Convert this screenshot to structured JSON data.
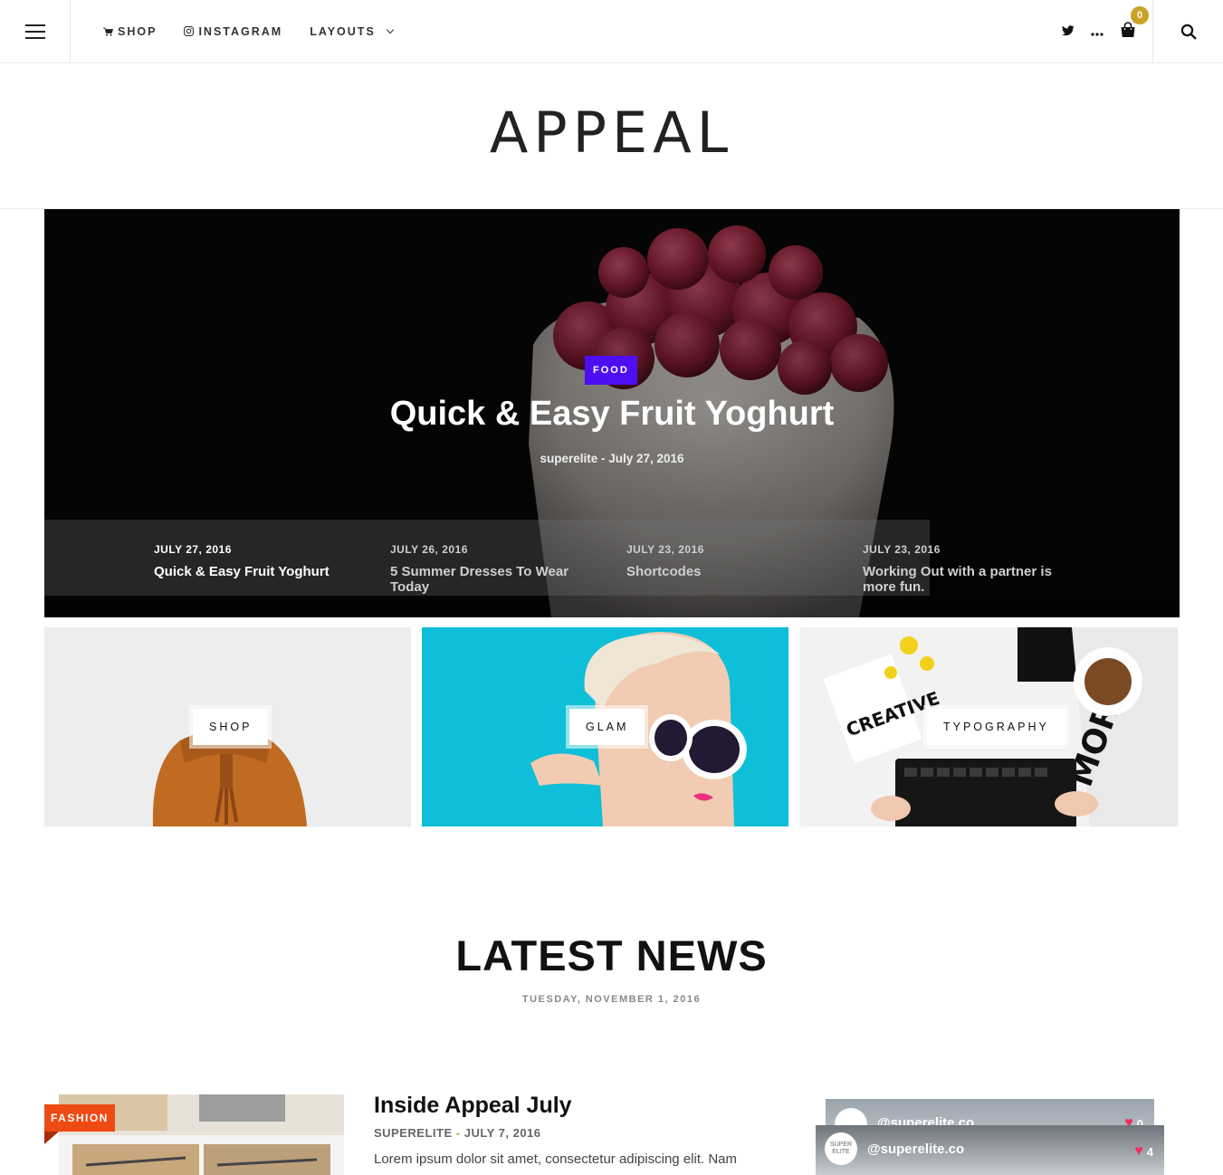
{
  "nav": {
    "shop_label": "SHOP",
    "instagram_label": "INSTAGRAM",
    "layouts_label": "LAYOUTS",
    "cart_count": "0"
  },
  "site": {
    "logo": "APPEAL"
  },
  "hero": {
    "category": "FOOD",
    "title": "Quick & Easy Fruit Yoghurt",
    "meta": "superelite - July 27, 2016",
    "category_color": "#4d0ef2",
    "slides": [
      {
        "date": "JULY 27, 2016",
        "title": "Quick & Easy Fruit Yoghurt"
      },
      {
        "date": "JULY 26, 2016",
        "title": "5 Summer Dresses To Wear Today"
      },
      {
        "date": "JULY 23, 2016",
        "title": "Shortcodes"
      },
      {
        "date": "JULY 23, 2016",
        "title": "Working Out with a partner is more fun."
      }
    ]
  },
  "tiles": [
    {
      "label": "SHOP"
    },
    {
      "label": "GLAM"
    },
    {
      "label": "TYPOGRAPHY"
    }
  ],
  "latest": {
    "title": "LATEST NEWS",
    "date": "TUESDAY, NOVEMBER 1, 2016"
  },
  "post": {
    "category": "FASHION",
    "category_color": "#ee4a13",
    "title": "Inside Appeal July",
    "author": "SUPERELITE",
    "date": "JULY 7, 2016",
    "excerpt": "Lorem ipsum dolor sit amet, consectetur adipiscing elit. Nam"
  },
  "instagram": {
    "back": {
      "handle": "@superelite.co",
      "likes": "0"
    },
    "front": {
      "handle": "@superelite.co",
      "likes": "4",
      "avatar_text": "SUPER ELITE"
    }
  },
  "colors": {
    "accent": "#c9a227",
    "heart": "#ef2e62"
  }
}
